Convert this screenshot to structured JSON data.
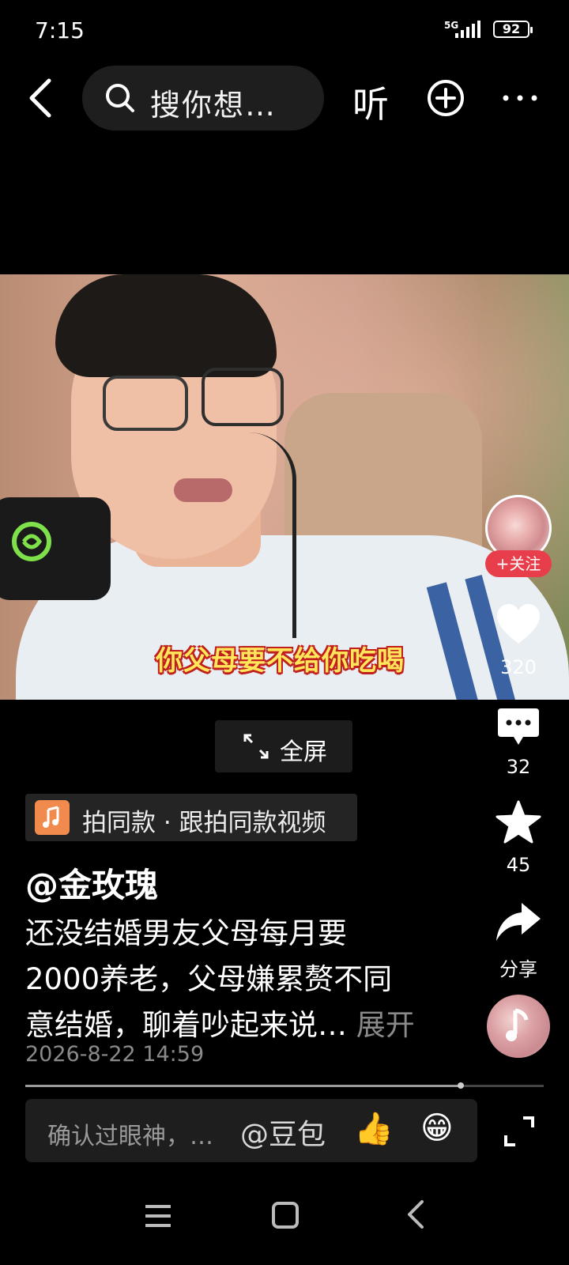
{
  "status_bar": {
    "time": "7:15",
    "network": "5G",
    "battery": "92"
  },
  "top_nav": {
    "search_placeholder": "搜你想…",
    "listen_label": "听"
  },
  "video": {
    "caption": "你父母要不给你吃喝",
    "fullscreen_label": "全屏"
  },
  "rail": {
    "follow_label": "+关注",
    "likes": "320",
    "comments": "32",
    "favorites": "45",
    "share_label": "分享"
  },
  "post": {
    "tag_text": "拍同款 · 跟拍同款视频",
    "author": "@金玫瑰",
    "desc_lines": [
      "还没结婚男友父母每月要",
      "2000养老，父母嫌累赘不同",
      "意结婚，聊着吵起来说…"
    ],
    "expand_label": "展开",
    "date": "2026-8-22 14:59",
    "progress": 0.84
  },
  "comment_bar": {
    "placeholder": "确认过眼神，…",
    "at_label": "@豆包",
    "thumb_emoji": "👍",
    "grin_emoji": "😁"
  }
}
